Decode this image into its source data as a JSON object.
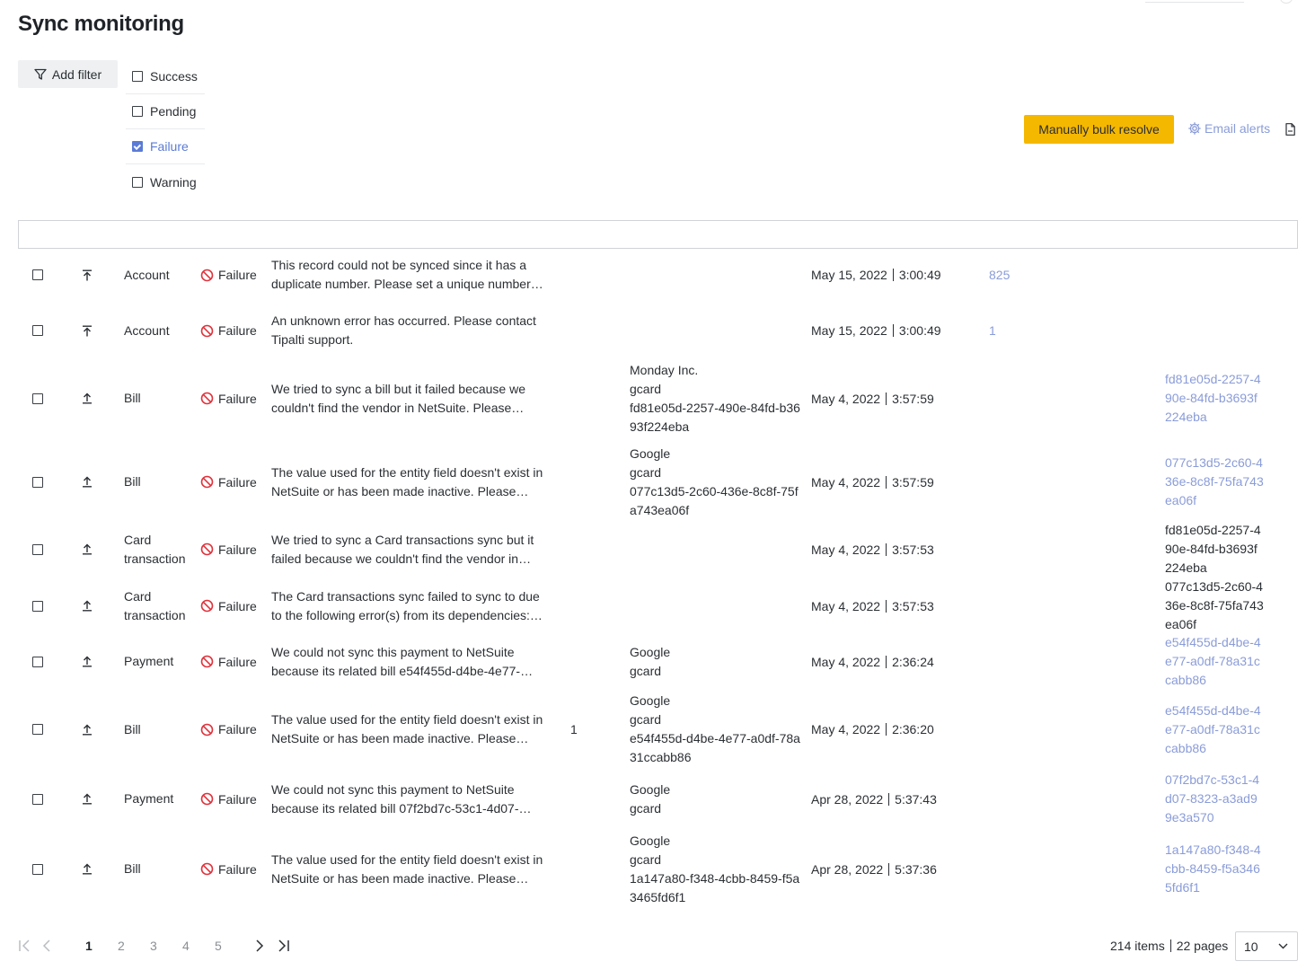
{
  "page": {
    "title": "Sync monitoring"
  },
  "filters": {
    "add_filter_label": "Add filter",
    "statuses": [
      {
        "label": "Success",
        "checked": false
      },
      {
        "label": "Pending",
        "checked": false
      },
      {
        "label": "Failure",
        "checked": true
      },
      {
        "label": "Warning",
        "checked": false
      }
    ]
  },
  "toolbar": {
    "bulk_resolve_label": "Manually bulk resolve",
    "email_alerts_label": "Email alerts"
  },
  "colors": {
    "accent": "#5b7bd5",
    "link": "#8a9cd8",
    "bulk_button": "#f5b800",
    "failure": "#e0323b"
  },
  "rows": [
    {
      "direction": "upload-top-icon",
      "type": "Account",
      "status": "Failure",
      "message": "This record could not be synced since it has a duplicate number. Please set a unique number…",
      "number": "",
      "entity": "",
      "date": "May 15, 2022",
      "time": "3:00:49",
      "link": "825",
      "ref": "",
      "ref_linked": false
    },
    {
      "direction": "upload-top-icon",
      "type": "Account",
      "status": "Failure",
      "message": "An unknown error has occurred. Please contact Tipalti support.",
      "number": "",
      "entity": "",
      "date": "May 15, 2022",
      "time": "3:00:49",
      "link": "1",
      "ref": "",
      "ref_linked": false
    },
    {
      "direction": "upload-icon",
      "type": "Bill",
      "status": "Failure",
      "message": "We tried to sync a bill but it failed because we couldn't find the vendor in NetSuite. Please…",
      "number": "",
      "entity": "Monday Inc.\ngcard\nfd81e05d-2257-490e-84fd-b3693f224eba",
      "date": "May 4, 2022",
      "time": "3:57:59",
      "link": "",
      "ref": "fd81e05d-2257-490e-84fd-b3693f224eba",
      "ref_linked": true
    },
    {
      "direction": "upload-icon",
      "type": "Bill",
      "status": "Failure",
      "message": "The value used for the entity field doesn't exist in NetSuite or has been made inactive. Please…",
      "number": "",
      "entity": "Google\ngcard\n077c13d5-2c60-436e-8c8f-75fa743ea06f",
      "date": "May 4, 2022",
      "time": "3:57:59",
      "link": "",
      "ref": "077c13d5-2c60-436e-8c8f-75fa743ea06f",
      "ref_linked": true
    },
    {
      "direction": "upload-icon",
      "type": "Card transaction",
      "status": "Failure",
      "message": "We tried to sync a Card transactions sync but it failed because we couldn't find the vendor in…",
      "number": "",
      "entity": "",
      "date": "May 4, 2022",
      "time": "3:57:53",
      "link": "",
      "ref": "fd81e05d-2257-490e-84fd-b3693f224eba",
      "ref_linked": false
    },
    {
      "direction": "upload-icon",
      "type": "Card transaction",
      "status": "Failure",
      "message": "The Card transactions sync failed to sync to due to the following error(s) from its dependencies:…",
      "number": "",
      "entity": "",
      "date": "May 4, 2022",
      "time": "3:57:53",
      "link": "",
      "ref": "077c13d5-2c60-436e-8c8f-75fa743ea06f",
      "ref_linked": false
    },
    {
      "direction": "upload-icon",
      "type": "Payment",
      "status": "Failure",
      "message": "We could not sync this payment to NetSuite because its related bill e54f455d-d4be-4e77-…",
      "number": "",
      "entity": "Google\ngcard",
      "date": "May 4, 2022",
      "time": "2:36:24",
      "link": "",
      "ref": "e54f455d-d4be-4e77-a0df-78a31ccabb86",
      "ref_linked": true
    },
    {
      "direction": "upload-icon",
      "type": "Bill",
      "status": "Failure",
      "message": "The value used for the entity field doesn't exist in NetSuite or has been made inactive. Please…",
      "number": "1",
      "entity": "Google\ngcard\ne54f455d-d4be-4e77-a0df-78a31ccabb86",
      "date": "May 4, 2022",
      "time": "2:36:20",
      "link": "",
      "ref": "e54f455d-d4be-4e77-a0df-78a31ccabb86",
      "ref_linked": true
    },
    {
      "direction": "upload-icon",
      "type": "Payment",
      "status": "Failure",
      "message": "We could not sync this payment to NetSuite because its related bill 07f2bd7c-53c1-4d07-…",
      "number": "",
      "entity": "Google\ngcard",
      "date": "Apr 28, 2022",
      "time": "5:37:43",
      "link": "",
      "ref": "07f2bd7c-53c1-4d07-8323-a3ad99e3a570",
      "ref_linked": true
    },
    {
      "direction": "upload-icon",
      "type": "Bill",
      "status": "Failure",
      "message": "The value used for the entity field doesn't exist in NetSuite or has been made inactive. Please…",
      "number": "",
      "entity": "Google\ngcard\n1a147a80-f348-4cbb-8459-f5a3465fd6f1",
      "date": "Apr 28, 2022",
      "time": "5:37:36",
      "link": "",
      "ref": "1a147a80-f348-4cbb-8459-f5a3465fd6f1",
      "ref_linked": true
    }
  ],
  "pagination": {
    "pages": [
      "1",
      "2",
      "3",
      "4",
      "5"
    ],
    "current": "1",
    "items_label": "214 items",
    "pages_label": "22 pages",
    "page_size": "10"
  }
}
